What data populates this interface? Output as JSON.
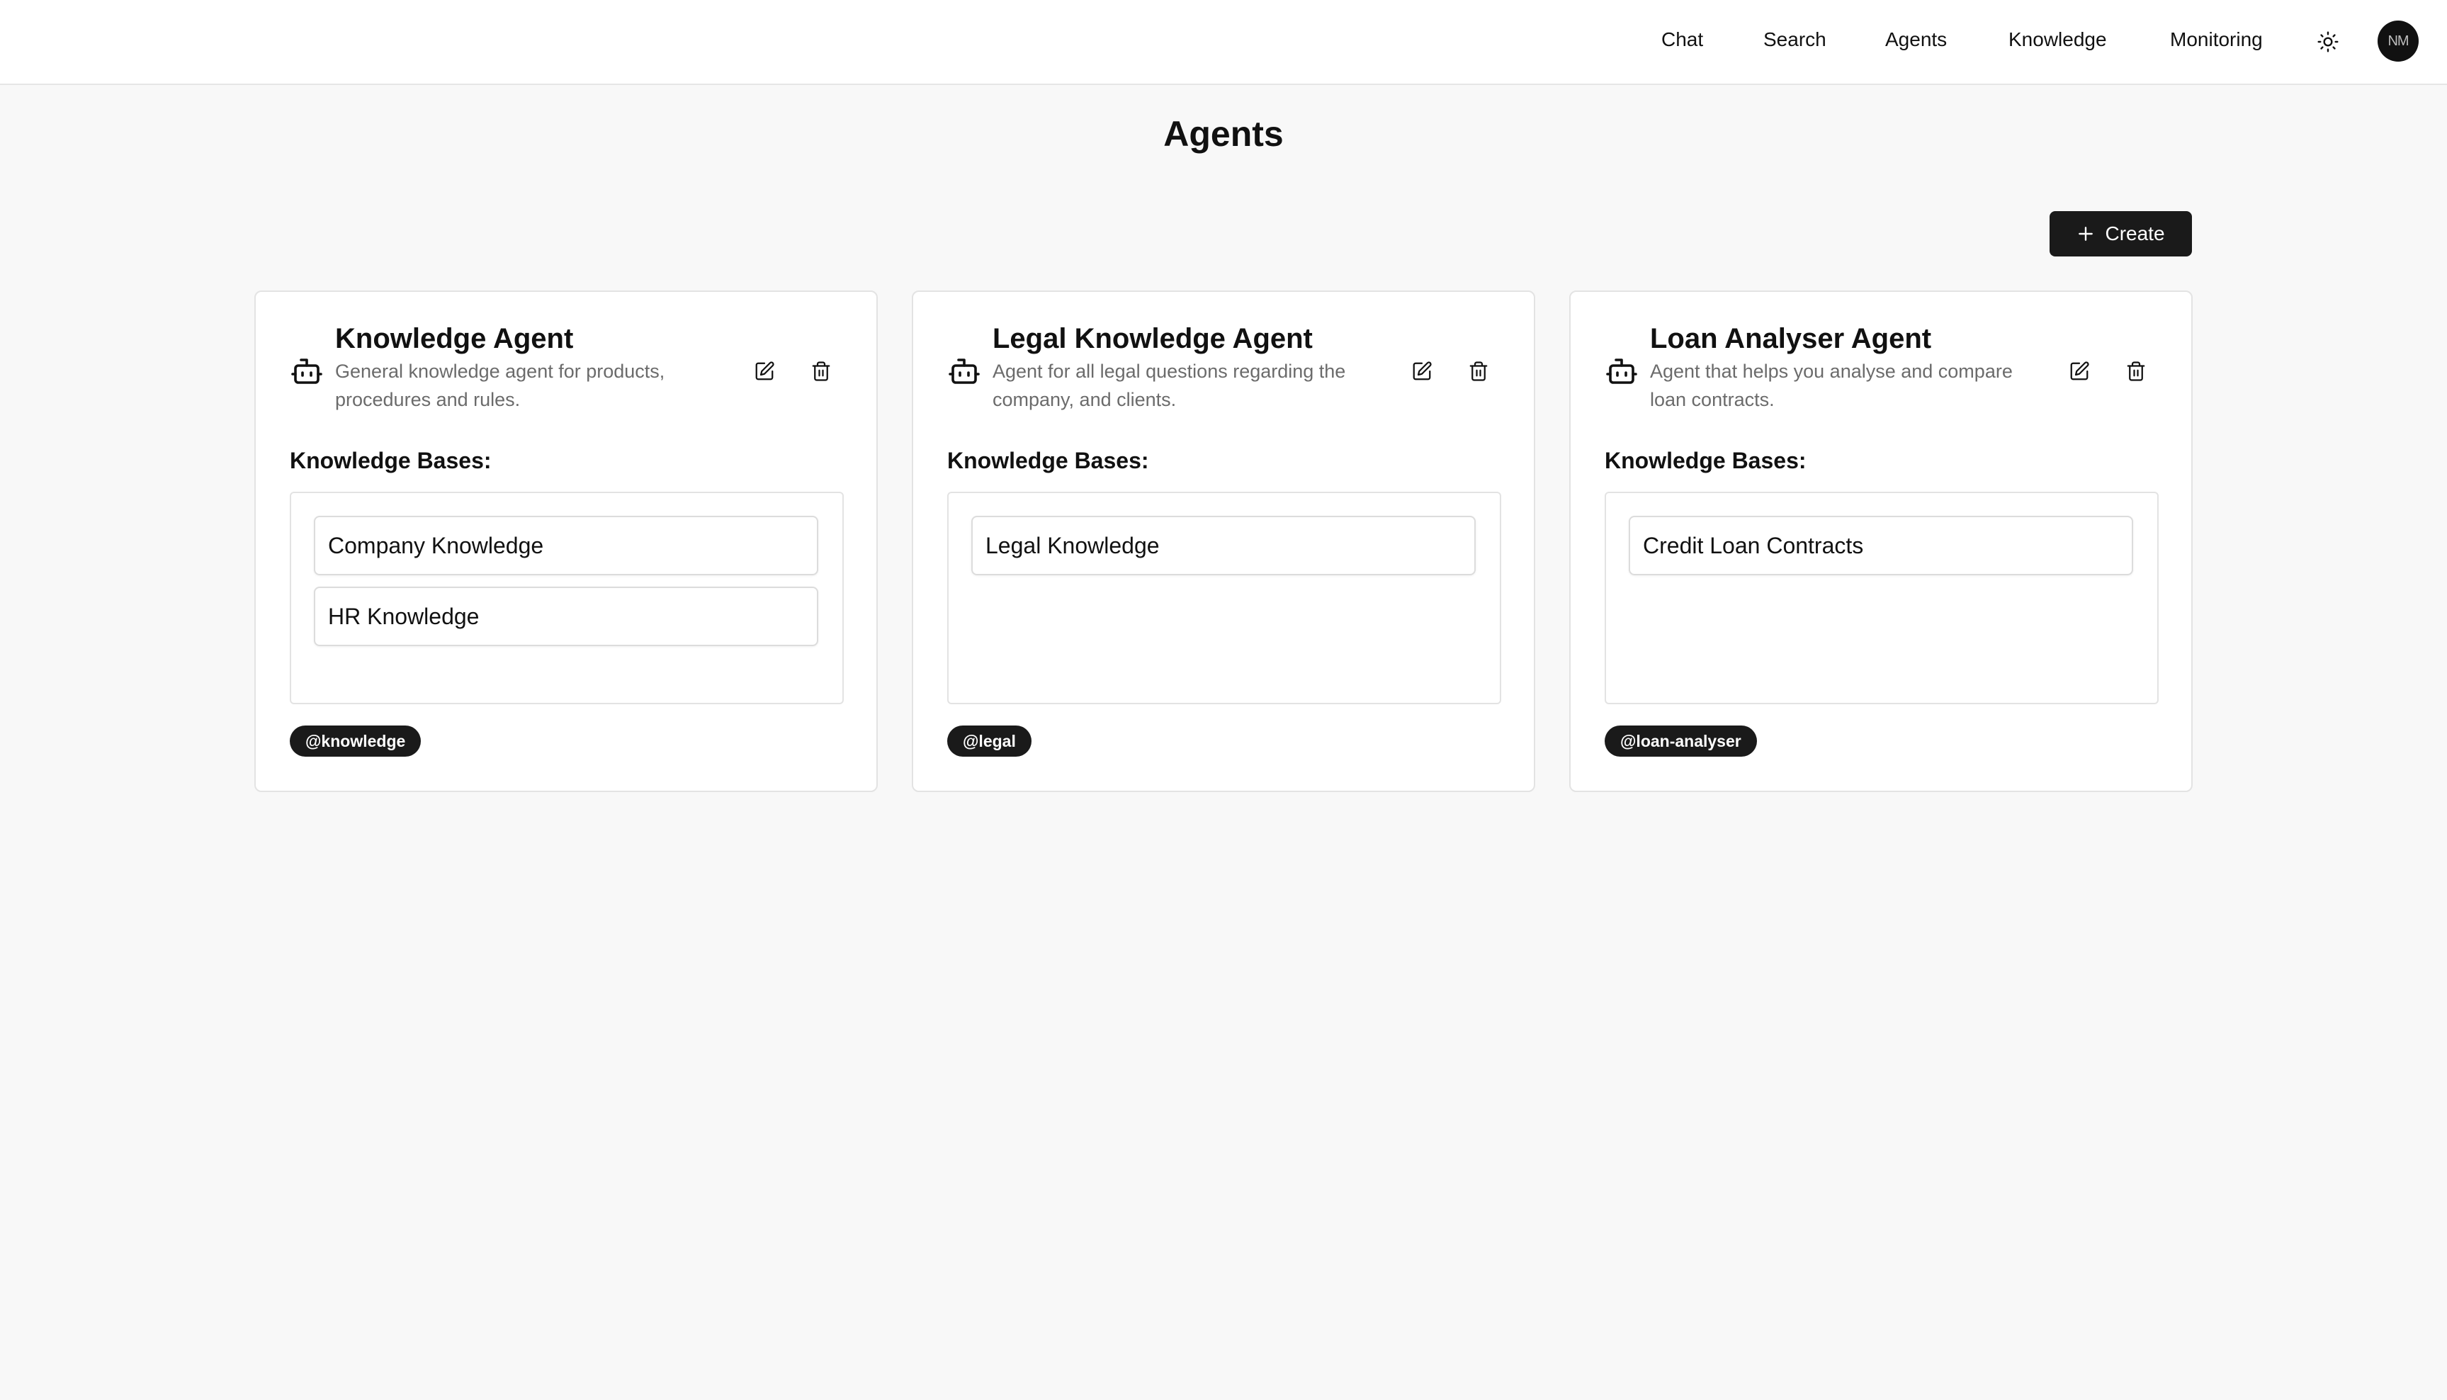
{
  "nav": {
    "items": [
      "Chat",
      "Search",
      "Agents",
      "Knowledge",
      "Monitoring"
    ],
    "theme_icon": "sun-icon",
    "avatar_initials": "NM"
  },
  "page": {
    "title": "Agents",
    "create_label": "Create"
  },
  "agents": [
    {
      "name": "Knowledge Agent",
      "description": "General knowledge agent for products, procedures and rules.",
      "kb_label": "Knowledge Bases:",
      "knowledge_bases": [
        "Company Knowledge",
        "HR Knowledge"
      ],
      "handle": "@knowledge"
    },
    {
      "name": "Legal Knowledge Agent",
      "description": "Agent for all legal questions regarding the company, and clients.",
      "kb_label": "Knowledge Bases:",
      "knowledge_bases": [
        "Legal Knowledge"
      ],
      "handle": "@legal"
    },
    {
      "name": "Loan Analyser Agent",
      "description": "Agent that helps you analyse and compare loan contracts.",
      "kb_label": "Knowledge Bases:",
      "knowledge_bases": [
        "Credit Loan Contracts"
      ],
      "handle": "@loan-analyser"
    }
  ],
  "colors": {
    "background": "#f8f8f8",
    "accent_dark": "#1a1a1a",
    "muted_text": "#6b6b6b"
  }
}
